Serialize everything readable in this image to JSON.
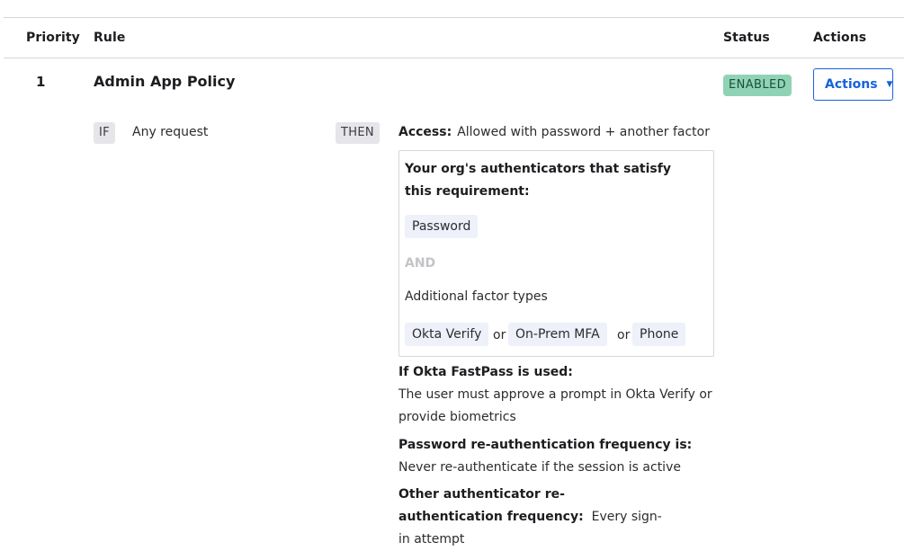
{
  "table": {
    "headers": {
      "priority": "Priority",
      "rule": "Rule",
      "status": "Status",
      "actions": "Actions"
    }
  },
  "rule": {
    "priority": "1",
    "name": "Admin App Policy",
    "status": "ENABLED",
    "actions_label": "Actions",
    "if_label": "IF",
    "condition": "Any request",
    "then_label": "THEN",
    "access_label": "Access:",
    "access_value": "Allowed with password + another factor",
    "authenticators": {
      "heading": "Your org's authenticators that satisfy this requirement:",
      "primary": "Password",
      "and_label": "AND",
      "additional_label": "Additional factor types",
      "factors": [
        "Okta Verify",
        "On-Prem MFA",
        "Phone"
      ],
      "or_word": "or"
    },
    "fastpass": {
      "label": "If Okta FastPass is used:",
      "value": "The user must approve a prompt in Okta Verify or provide biometrics"
    },
    "password_reauth": {
      "label": "Password re-authentication frequency is:",
      "value": "Never re-authenticate if the session is active"
    },
    "other_reauth": {
      "label": "Other authenticator re-authentication frequency:",
      "value": "Every sign-in attempt"
    }
  },
  "colors": {
    "status_badge_bg": "#8fd3b4",
    "status_badge_text": "#1b4f3a",
    "accent_blue": "#1662dd",
    "chip_bg": "#e6e6ea",
    "pill_bg": "#eef0fa",
    "border": "#d7d7dc"
  },
  "icons": {
    "actions_caret": "caret-down-icon"
  }
}
